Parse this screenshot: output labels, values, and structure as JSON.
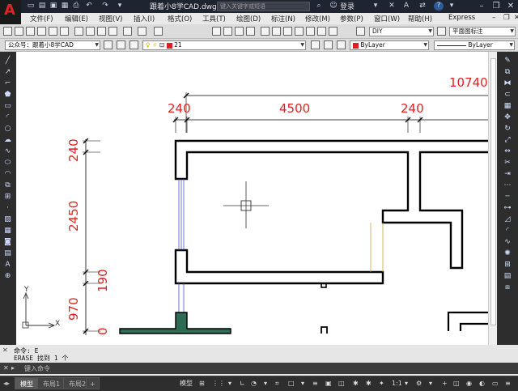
{
  "app": {
    "title": "跟着小8学CAD.dwg",
    "logo": "A",
    "search_placeholder": "键入关键字或短语",
    "login": "登录",
    "help_glyph": "?"
  },
  "menu": [
    "文件(F)",
    "编辑(E)",
    "视图(V)",
    "插入(I)",
    "格式(O)",
    "工具(T)",
    "绘图(D)",
    "标注(N)",
    "修改(M)",
    "参数(P)",
    "窗口(W)",
    "帮助(H)",
    "Express"
  ],
  "toolbar": {
    "layer_style": "DIY",
    "dim_style": "平面图标注",
    "workspace_text": "公众号：跟着小8学CAD",
    "layer_number": "21",
    "color_value": "ByLayer",
    "linetype_value": "ByLayer"
  },
  "colors": {
    "accent_red": "#e22020",
    "wall_fill": "#2d6b54",
    "window_blue": "#4a59c8",
    "door_orange": "#c8a24a"
  },
  "drawing": {
    "dims_top": [
      "10740",
      "240",
      "4500",
      "240"
    ],
    "dims_left": [
      "240",
      "2450",
      "190",
      "970",
      "0"
    ]
  },
  "ucs": {
    "x_label": "X",
    "y_label": "Y"
  },
  "command": {
    "line1": "命令: E",
    "line2": "ERASE 找到 1 个",
    "input_placeholder": "键入命令"
  },
  "tabs": {
    "model": "模型",
    "layout1": "布局1",
    "layout2": "布局2"
  },
  "status": {
    "space": "模型",
    "scale": "1:1"
  },
  "icons": {
    "tool_names": [
      "line-icon",
      "polyline-icon",
      "circle-icon",
      "arc-icon",
      "rectangle-icon",
      "hatch-icon",
      "text-icon"
    ]
  }
}
